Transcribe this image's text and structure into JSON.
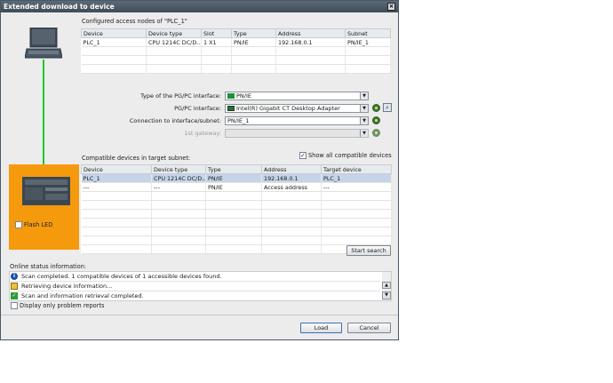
{
  "window": {
    "title": "Extended download to device",
    "close_glyph": "×"
  },
  "configured": {
    "label": "Configured access nodes of \"PLC_1\"",
    "columns": [
      "Device",
      "Device type",
      "Slot",
      "Type",
      "Address",
      "Subnet"
    ],
    "rows": [
      [
        "PLC_1",
        "CPU 1214C DC/D...",
        "1 X1",
        "PN/IE",
        "192.168.0.1",
        "PN/IE_1"
      ]
    ]
  },
  "form": {
    "pgpc_type_label": "Type of the PG/PC interface:",
    "pgpc_type_value": "PN/IE",
    "pgpc_interface_label": "PG/PC interface:",
    "pgpc_interface_value": "Intel(R) Gigabit CT Desktop Adapter",
    "connection_label": "Connection to interface/subnet:",
    "connection_value": "PN/IE_1",
    "gateway_label": "1st gateway:",
    "gateway_value": ""
  },
  "compatible": {
    "label": "Compatible devices in target subnet:",
    "show_all_label": "Show all compatible devices",
    "show_all_checked": true,
    "columns": [
      "Device",
      "Device type",
      "Type",
      "Address",
      "Target device"
    ],
    "rows": [
      [
        "PLC_1",
        "CPU 1214C DC/D...",
        "PN/IE",
        "192.168.0.1",
        "PLC_1"
      ],
      [
        "---",
        "---",
        "PN/IE",
        "Access address",
        "---"
      ]
    ]
  },
  "flash_led_label": "Flash LED",
  "start_search_label": "Start search",
  "online_status": {
    "label": "Online status information:",
    "messages": [
      {
        "icon": "info-icon",
        "text": "Scan completed. 1 compatible devices of 1 accessible devices found."
      },
      {
        "icon": "retrieving-icon",
        "text": "Retrieving device information..."
      },
      {
        "icon": "check-icon",
        "text": "Scan and information retrieval completed."
      }
    ],
    "only_problems_label": "Display only problem reports"
  },
  "buttons": {
    "load": "Load",
    "cancel": "Cancel"
  },
  "colors": {
    "accent": "#f59a0d",
    "link_line": "#22c722",
    "title_bar": "#4a5866"
  }
}
